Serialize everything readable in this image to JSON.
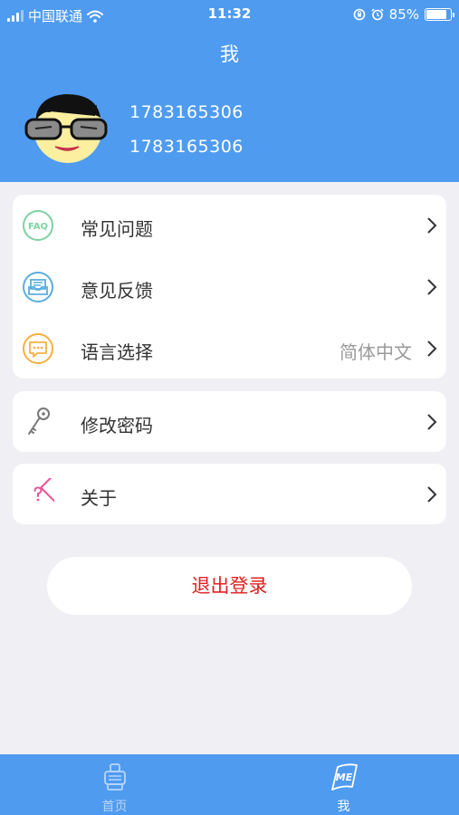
{
  "status_bar": {
    "carrier": "中国联通",
    "time": "11:32",
    "battery_percent": "85%",
    "battery_level": 0.85,
    "icons": [
      "signal-icon",
      "wifi-icon",
      "orientation-lock-icon",
      "alarm-icon",
      "battery-icon"
    ]
  },
  "header": {
    "title": "我",
    "user_line1": "1783165306",
    "user_line2": "1783165306"
  },
  "menu": {
    "faq": {
      "label": "常见问题",
      "icon": "faq-icon"
    },
    "feedback": {
      "label": "意见反馈",
      "icon": "feedback-icon"
    },
    "language": {
      "label": "语言选择",
      "value": "简体中文",
      "icon": "chat-bubble-icon"
    },
    "password": {
      "label": "修改密码",
      "icon": "key-icon"
    },
    "about": {
      "label": "关于",
      "icon": "question-diamond-icon"
    }
  },
  "logout_label": "退出登录",
  "tabbar": {
    "home_label": "首页",
    "me_label": "我",
    "active": "me"
  },
  "colors": {
    "primary": "#4f9bf0",
    "background": "#efeff4",
    "logout_text": "#e02020",
    "faq": "#7fd2a3",
    "feedback": "#5aaee0",
    "language": "#f5b13d",
    "about": "#e8579b"
  }
}
